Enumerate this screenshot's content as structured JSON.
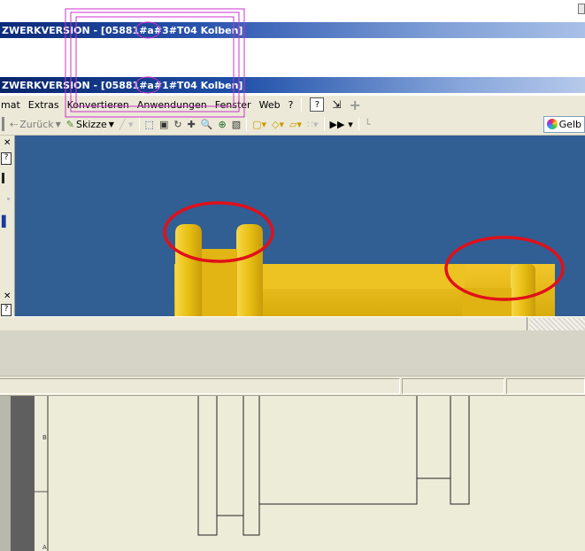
{
  "window_outer": {
    "title": "ZWERKVERSION - [05881#a#3#T04 Kolben]"
  },
  "window_inner": {
    "title": "ZWERKVERSION - [05881#a#1#T04 Kolben]"
  },
  "menu": {
    "items": [
      "mat",
      "Extras",
      "Konvertieren",
      "Anwendungen",
      "Fenster",
      "Web",
      "?"
    ]
  },
  "toolbar": {
    "back_label": "Zurück",
    "sketch_label": "Skizze",
    "color_label": "Gelb"
  },
  "drawing_border": {
    "row_labels": [
      "B",
      "A"
    ]
  },
  "colors": {
    "viewport_bg": "#315e93",
    "part_yellow": "#f0c828",
    "annotation_red": "#e0101a",
    "annotation_magenta": "#cc33cc",
    "drawing_bg": "#edecd8"
  },
  "icons": [
    "window-close-icon",
    "help-icon",
    "save-icon",
    "arrow-back-icon",
    "sketch-icon",
    "zoom-icon",
    "rotate-icon",
    "extrude-icon",
    "plus-icon",
    "color-swatch-icon"
  ]
}
